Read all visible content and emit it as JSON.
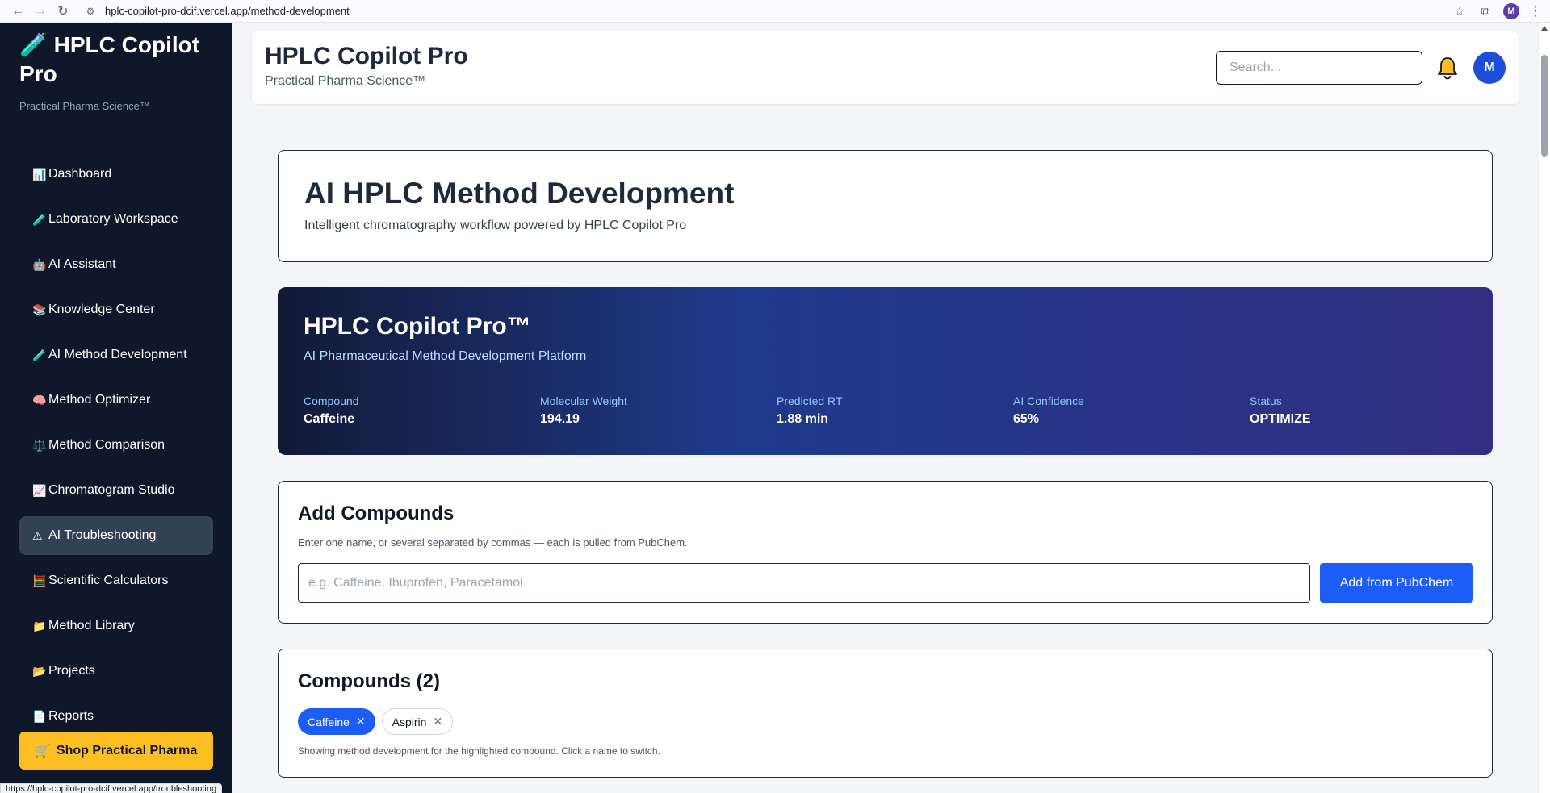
{
  "browser": {
    "url": "hplc-copilot-pro-dcif.vercel.app/method-development",
    "profile_initial": "M",
    "status_url": "https://hplc-copilot-pro-dcif.vercel.app/troubleshooting"
  },
  "sidebar": {
    "brand_icon": "🧪",
    "brand_title": "HPLC Copilot Pro",
    "brand_subtitle": "Practical Pharma Science™",
    "items": [
      {
        "icon": "📊",
        "label": "Dashboard",
        "active": false
      },
      {
        "icon": "🧪",
        "label": "Laboratory Workspace",
        "active": false
      },
      {
        "icon": "🤖",
        "label": "AI Assistant",
        "active": false
      },
      {
        "icon": "📚",
        "label": "Knowledge Center",
        "active": false
      },
      {
        "icon": "🧪",
        "label": "AI Method Development",
        "active": false
      },
      {
        "icon": "🧠",
        "label": "Method Optimizer",
        "active": false
      },
      {
        "icon": "⚖️",
        "label": "Method Comparison",
        "active": false
      },
      {
        "icon": "📈",
        "label": "Chromatogram Studio",
        "active": false
      },
      {
        "icon": "⚠",
        "label": "AI Troubleshooting",
        "active": true
      },
      {
        "icon": "🧮",
        "label": "Scientific Calculators",
        "active": false
      },
      {
        "icon": "📁",
        "label": "Method Library",
        "active": false
      },
      {
        "icon": "📂",
        "label": "Projects",
        "active": false
      },
      {
        "icon": "📄",
        "label": "Reports",
        "active": false
      }
    ],
    "shop_button": {
      "icon": "🛒",
      "label": "Shop Practical Pharma"
    }
  },
  "header": {
    "title": "HPLC Copilot Pro",
    "subtitle": "Practical Pharma Science™",
    "search_placeholder": "Search...",
    "avatar_initial": "M"
  },
  "hero": {
    "title": "AI HPLC Method Development",
    "subtitle": "Intelligent chromatography workflow powered by HPLC Copilot Pro"
  },
  "banner": {
    "title": "HPLC Copilot Pro™",
    "subtitle": "AI Pharmaceutical Method Development Platform",
    "stats": [
      {
        "label": "Compound",
        "value": "Caffeine"
      },
      {
        "label": "Molecular Weight",
        "value": "194.19"
      },
      {
        "label": "Predicted RT",
        "value": "1.88 min"
      },
      {
        "label": "AI Confidence",
        "value": "65%"
      },
      {
        "label": "Status",
        "value": "OPTIMIZE"
      }
    ]
  },
  "add_compounds": {
    "title": "Add Compounds",
    "help": "Enter one name, or several separated by commas — each is pulled from PubChem.",
    "input_placeholder": "e.g. Caffeine, Ibuprofen, Paracetamol",
    "button_label": "Add from PubChem"
  },
  "compounds": {
    "title": "Compounds (2)",
    "chips": [
      {
        "label": "Caffeine",
        "active": true
      },
      {
        "label": "Aspirin",
        "active": false
      }
    ],
    "help": "Showing method development for the highlighted compound. Click a name to switch."
  }
}
